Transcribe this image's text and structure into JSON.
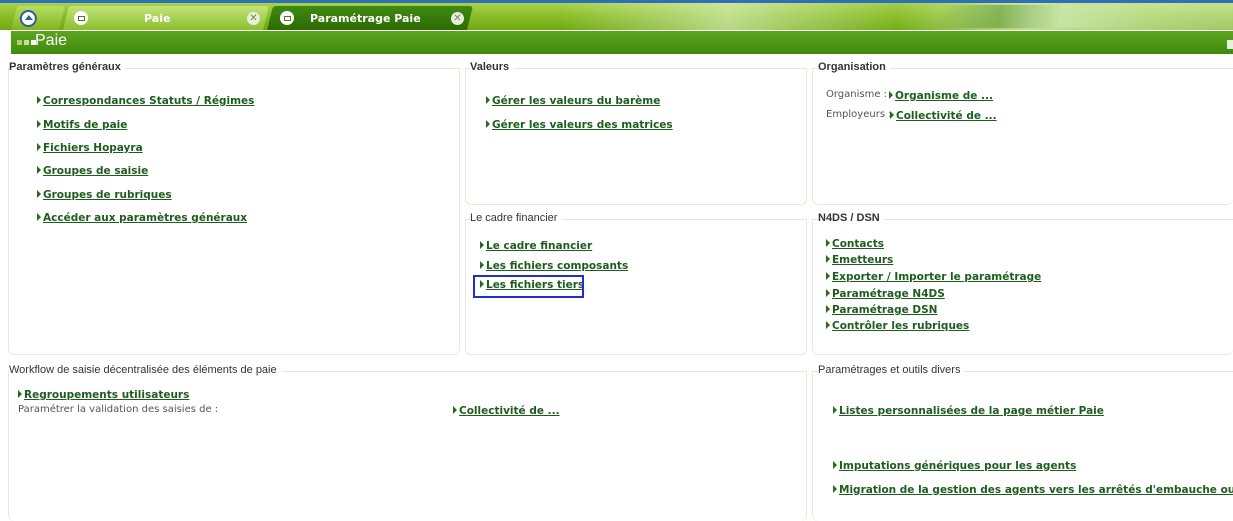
{
  "tabs": {
    "paie_label": "Paie",
    "param_label": "Paramétrage Paie"
  },
  "header": {
    "title": "Paie"
  },
  "sections": {
    "general": {
      "title": "Paramètres généraux",
      "links": [
        "Correspondances Statuts / Régimes",
        "Motifs de paie",
        "Fichiers Hopayra",
        "Groupes de saisie",
        "Groupes de rubriques",
        "Accéder aux paramètres généraux"
      ]
    },
    "valeurs": {
      "title": "Valeurs",
      "links": [
        "Gérer les valeurs du barème",
        "Gérer les valeurs des matrices"
      ]
    },
    "organisation": {
      "title": "Organisation",
      "organisme_label": "Organisme :",
      "organisme_link": "Organisme de ...",
      "employeurs_label": "Employeurs :",
      "employeurs_link": "Collectivité de ..."
    },
    "cadre": {
      "title": "Le cadre financier",
      "links": [
        "Le cadre financier",
        "Les fichiers composants",
        "Les fichiers tiers"
      ]
    },
    "n4ds": {
      "title": "N4DS / DSN",
      "links": [
        "Contacts",
        "Emetteurs",
        "Exporter / Importer le paramétrage",
        "Paramétrage N4DS",
        "Paramétrage DSN",
        "Contrôler les rubriques"
      ]
    },
    "workflow": {
      "title": "Workflow de saisie décentralisée des éléments de paie",
      "link": "Regroupements utilisateurs",
      "validation_label": "Paramétrer la validation des saisies de :",
      "validation_link": "Collectivité de ..."
    },
    "outils": {
      "title": "Paramétrages et outils divers",
      "links": [
        "Listes personnalisées de la page métier Paie",
        "Imputations génériques pour les agents",
        "Migration de la gestion des agents vers les arrêtés d'embauche ou contrats"
      ]
    }
  },
  "colors": {
    "accent_green": "#3f8a0f",
    "link_green": "#1d5d1d",
    "highlight_blue": "#1f2fc8"
  }
}
